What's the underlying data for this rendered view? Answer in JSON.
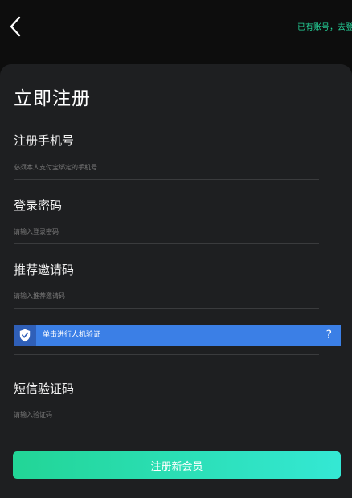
{
  "header": {
    "back_icon": "chevron-left-icon",
    "login_link": "已有账号，去登录"
  },
  "form": {
    "title": "立即注册",
    "phone": {
      "label": "注册手机号",
      "placeholder": "必须本人支付宝绑定的手机号"
    },
    "password": {
      "label": "登录密码",
      "placeholder": "请输入登录密码"
    },
    "invite": {
      "label": "推荐邀请码",
      "placeholder": "请输入推荐邀请码"
    },
    "captcha": {
      "icon": "shield-check-icon",
      "text": "单击进行人机验证",
      "help": "?"
    },
    "sms": {
      "label": "短信验证码",
      "placeholder": "请输入验证码"
    },
    "submit_label": "注册新会员"
  },
  "colors": {
    "accent_green": "#25d49a",
    "captcha_blue": "#3b7fe6",
    "button_gradient_start": "#22d596",
    "button_gradient_end": "#34e8d4"
  }
}
